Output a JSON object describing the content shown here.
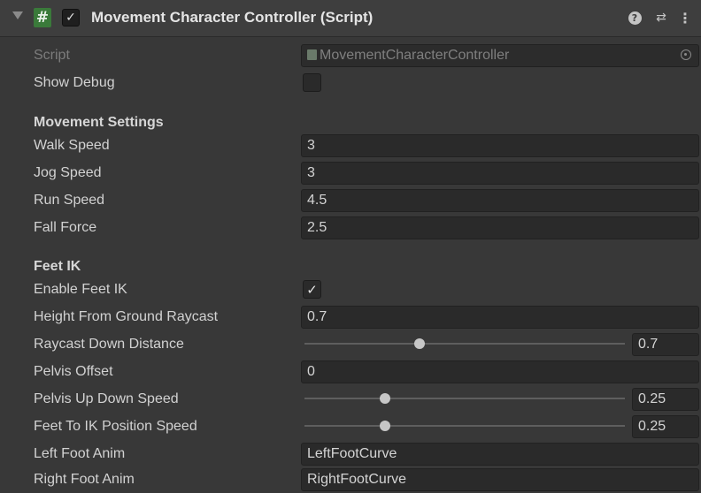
{
  "header": {
    "title": "Movement Character Controller (Script)",
    "enabled_check": "✓",
    "script_icon_glyph": "#",
    "icons": [
      "foldout-arrow-icon",
      "script-icon",
      "help-icon",
      "presets-icon",
      "kebab-menu-icon"
    ],
    "menu_glyph": "⋮",
    "presets_glyph": "⇄",
    "help_glyph": "?"
  },
  "script": {
    "label": "Script",
    "value": "MovementCharacterController"
  },
  "show_debug": {
    "label": "Show Debug",
    "checked": false
  },
  "movement_settings": {
    "title": "Movement Settings",
    "walk_speed": {
      "label": "Walk Speed",
      "value": "3"
    },
    "jog_speed": {
      "label": "Jog Speed",
      "value": "3"
    },
    "run_speed": {
      "label": "Run Speed",
      "value": "4.5"
    },
    "fall_force": {
      "label": "Fall Force",
      "value": "2.5"
    }
  },
  "feet_ik": {
    "title": "Feet IK",
    "enable_feet_ik": {
      "label": "Enable Feet IK",
      "checked": true,
      "check_glyph": "✓"
    },
    "height_from_ground_raycast": {
      "label": "Height From Ground Raycast",
      "value": "0.7"
    },
    "raycast_down_distance": {
      "label": "Raycast Down Distance",
      "value": "0.7",
      "slider_fraction": 0.36
    },
    "pelvis_offset": {
      "label": "Pelvis Offset",
      "value": "0"
    },
    "pelvis_up_down_speed": {
      "label": "Pelvis Up Down Speed",
      "value": "0.25",
      "slider_fraction": 0.25
    },
    "feet_to_ik_position_speed": {
      "label": "Feet To IK Position Speed",
      "value": "0.25",
      "slider_fraction": 0.25
    },
    "left_foot_anim": {
      "label": "Left Foot Anim",
      "value": "LeftFootCurve"
    },
    "right_foot_anim": {
      "label": "Right Foot Anim",
      "value": "RightFootCurve"
    }
  },
  "colors": {
    "background": "#383838",
    "header": "#3e3e3e",
    "field": "#2a2a2a",
    "script_icon": "#3a7a3a",
    "text": "#d2d2d2"
  }
}
